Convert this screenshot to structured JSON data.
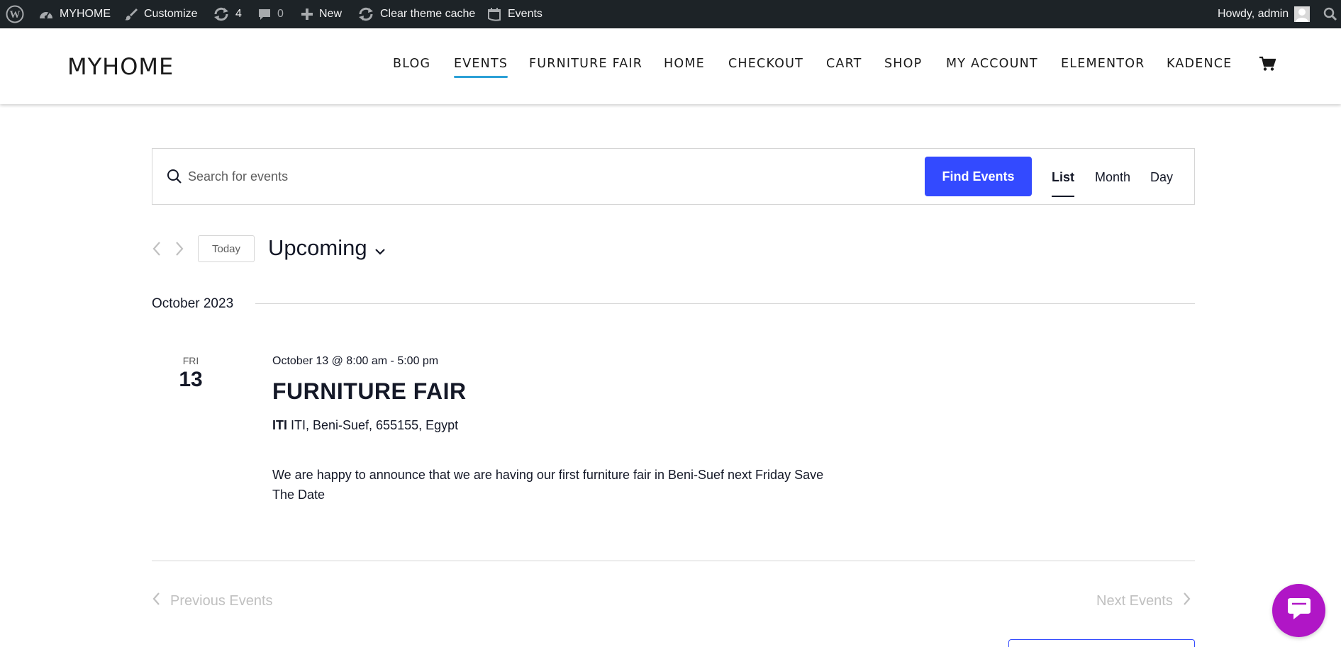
{
  "admin_bar": {
    "site_name": "MYHOME",
    "customize": "Customize",
    "updates_count": "4",
    "comments_count": "0",
    "new": "New",
    "clear_cache": "Clear theme cache",
    "events": "Events",
    "howdy": "Howdy, admin"
  },
  "header": {
    "site_title": "MYHOME",
    "nav": [
      "BLOG",
      "EVENTS",
      "FURNITURE FAIR",
      "HOME",
      "CHECKOUT",
      "CART",
      "SHOP",
      "MY ACCOUNT",
      "ELEMENTOR",
      "KADENCE"
    ],
    "active_nav": "EVENTS"
  },
  "events_bar": {
    "search_placeholder": "Search for events",
    "find_button": "Find Events",
    "views": [
      "List",
      "Month",
      "Day"
    ],
    "active_view": "List"
  },
  "date_nav": {
    "today": "Today",
    "upcoming": "Upcoming"
  },
  "month_separator": "October 2023",
  "event": {
    "dow": "FRI",
    "day": "13",
    "datetime": "October 13 @ 8:00 am - 5:00 pm",
    "title": "FURNITURE FAIR",
    "venue_name": "ITI",
    "venue_address": "ITI, Beni-Suef, 655155, Egypt",
    "description": "We are happy to announce that we are having our first furniture fair in Beni-Suef next Friday Save The Date"
  },
  "pagination": {
    "previous": "Previous Events",
    "next": "Next Events"
  },
  "colors": {
    "admin_bar_bg": "#1d2327",
    "accent_blue": "#334aff",
    "nav_underline": "#2ba0d6",
    "chat_bubble": "#b016c6"
  }
}
